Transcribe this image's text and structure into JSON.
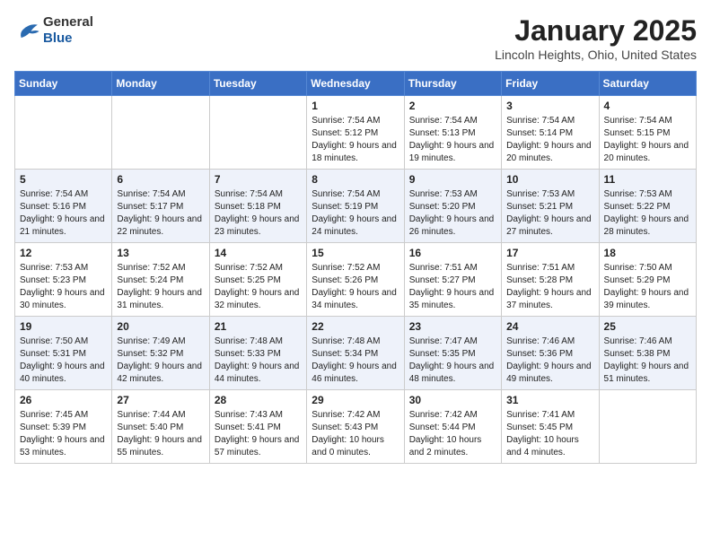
{
  "header": {
    "logo_general": "General",
    "logo_blue": "Blue",
    "month": "January 2025",
    "location": "Lincoln Heights, Ohio, United States"
  },
  "weekdays": [
    "Sunday",
    "Monday",
    "Tuesday",
    "Wednesday",
    "Thursday",
    "Friday",
    "Saturday"
  ],
  "weeks": [
    [
      {
        "day": "",
        "sunrise": "",
        "sunset": "",
        "daylight": ""
      },
      {
        "day": "",
        "sunrise": "",
        "sunset": "",
        "daylight": ""
      },
      {
        "day": "",
        "sunrise": "",
        "sunset": "",
        "daylight": ""
      },
      {
        "day": "1",
        "sunrise": "Sunrise: 7:54 AM",
        "sunset": "Sunset: 5:12 PM",
        "daylight": "Daylight: 9 hours and 18 minutes."
      },
      {
        "day": "2",
        "sunrise": "Sunrise: 7:54 AM",
        "sunset": "Sunset: 5:13 PM",
        "daylight": "Daylight: 9 hours and 19 minutes."
      },
      {
        "day": "3",
        "sunrise": "Sunrise: 7:54 AM",
        "sunset": "Sunset: 5:14 PM",
        "daylight": "Daylight: 9 hours and 20 minutes."
      },
      {
        "day": "4",
        "sunrise": "Sunrise: 7:54 AM",
        "sunset": "Sunset: 5:15 PM",
        "daylight": "Daylight: 9 hours and 20 minutes."
      }
    ],
    [
      {
        "day": "5",
        "sunrise": "Sunrise: 7:54 AM",
        "sunset": "Sunset: 5:16 PM",
        "daylight": "Daylight: 9 hours and 21 minutes."
      },
      {
        "day": "6",
        "sunrise": "Sunrise: 7:54 AM",
        "sunset": "Sunset: 5:17 PM",
        "daylight": "Daylight: 9 hours and 22 minutes."
      },
      {
        "day": "7",
        "sunrise": "Sunrise: 7:54 AM",
        "sunset": "Sunset: 5:18 PM",
        "daylight": "Daylight: 9 hours and 23 minutes."
      },
      {
        "day": "8",
        "sunrise": "Sunrise: 7:54 AM",
        "sunset": "Sunset: 5:19 PM",
        "daylight": "Daylight: 9 hours and 24 minutes."
      },
      {
        "day": "9",
        "sunrise": "Sunrise: 7:53 AM",
        "sunset": "Sunset: 5:20 PM",
        "daylight": "Daylight: 9 hours and 26 minutes."
      },
      {
        "day": "10",
        "sunrise": "Sunrise: 7:53 AM",
        "sunset": "Sunset: 5:21 PM",
        "daylight": "Daylight: 9 hours and 27 minutes."
      },
      {
        "day": "11",
        "sunrise": "Sunrise: 7:53 AM",
        "sunset": "Sunset: 5:22 PM",
        "daylight": "Daylight: 9 hours and 28 minutes."
      }
    ],
    [
      {
        "day": "12",
        "sunrise": "Sunrise: 7:53 AM",
        "sunset": "Sunset: 5:23 PM",
        "daylight": "Daylight: 9 hours and 30 minutes."
      },
      {
        "day": "13",
        "sunrise": "Sunrise: 7:52 AM",
        "sunset": "Sunset: 5:24 PM",
        "daylight": "Daylight: 9 hours and 31 minutes."
      },
      {
        "day": "14",
        "sunrise": "Sunrise: 7:52 AM",
        "sunset": "Sunset: 5:25 PM",
        "daylight": "Daylight: 9 hours and 32 minutes."
      },
      {
        "day": "15",
        "sunrise": "Sunrise: 7:52 AM",
        "sunset": "Sunset: 5:26 PM",
        "daylight": "Daylight: 9 hours and 34 minutes."
      },
      {
        "day": "16",
        "sunrise": "Sunrise: 7:51 AM",
        "sunset": "Sunset: 5:27 PM",
        "daylight": "Daylight: 9 hours and 35 minutes."
      },
      {
        "day": "17",
        "sunrise": "Sunrise: 7:51 AM",
        "sunset": "Sunset: 5:28 PM",
        "daylight": "Daylight: 9 hours and 37 minutes."
      },
      {
        "day": "18",
        "sunrise": "Sunrise: 7:50 AM",
        "sunset": "Sunset: 5:29 PM",
        "daylight": "Daylight: 9 hours and 39 minutes."
      }
    ],
    [
      {
        "day": "19",
        "sunrise": "Sunrise: 7:50 AM",
        "sunset": "Sunset: 5:31 PM",
        "daylight": "Daylight: 9 hours and 40 minutes."
      },
      {
        "day": "20",
        "sunrise": "Sunrise: 7:49 AM",
        "sunset": "Sunset: 5:32 PM",
        "daylight": "Daylight: 9 hours and 42 minutes."
      },
      {
        "day": "21",
        "sunrise": "Sunrise: 7:48 AM",
        "sunset": "Sunset: 5:33 PM",
        "daylight": "Daylight: 9 hours and 44 minutes."
      },
      {
        "day": "22",
        "sunrise": "Sunrise: 7:48 AM",
        "sunset": "Sunset: 5:34 PM",
        "daylight": "Daylight: 9 hours and 46 minutes."
      },
      {
        "day": "23",
        "sunrise": "Sunrise: 7:47 AM",
        "sunset": "Sunset: 5:35 PM",
        "daylight": "Daylight: 9 hours and 48 minutes."
      },
      {
        "day": "24",
        "sunrise": "Sunrise: 7:46 AM",
        "sunset": "Sunset: 5:36 PM",
        "daylight": "Daylight: 9 hours and 49 minutes."
      },
      {
        "day": "25",
        "sunrise": "Sunrise: 7:46 AM",
        "sunset": "Sunset: 5:38 PM",
        "daylight": "Daylight: 9 hours and 51 minutes."
      }
    ],
    [
      {
        "day": "26",
        "sunrise": "Sunrise: 7:45 AM",
        "sunset": "Sunset: 5:39 PM",
        "daylight": "Daylight: 9 hours and 53 minutes."
      },
      {
        "day": "27",
        "sunrise": "Sunrise: 7:44 AM",
        "sunset": "Sunset: 5:40 PM",
        "daylight": "Daylight: 9 hours and 55 minutes."
      },
      {
        "day": "28",
        "sunrise": "Sunrise: 7:43 AM",
        "sunset": "Sunset: 5:41 PM",
        "daylight": "Daylight: 9 hours and 57 minutes."
      },
      {
        "day": "29",
        "sunrise": "Sunrise: 7:42 AM",
        "sunset": "Sunset: 5:43 PM",
        "daylight": "Daylight: 10 hours and 0 minutes."
      },
      {
        "day": "30",
        "sunrise": "Sunrise: 7:42 AM",
        "sunset": "Sunset: 5:44 PM",
        "daylight": "Daylight: 10 hours and 2 minutes."
      },
      {
        "day": "31",
        "sunrise": "Sunrise: 7:41 AM",
        "sunset": "Sunset: 5:45 PM",
        "daylight": "Daylight: 10 hours and 4 minutes."
      },
      {
        "day": "",
        "sunrise": "",
        "sunset": "",
        "daylight": ""
      }
    ]
  ]
}
